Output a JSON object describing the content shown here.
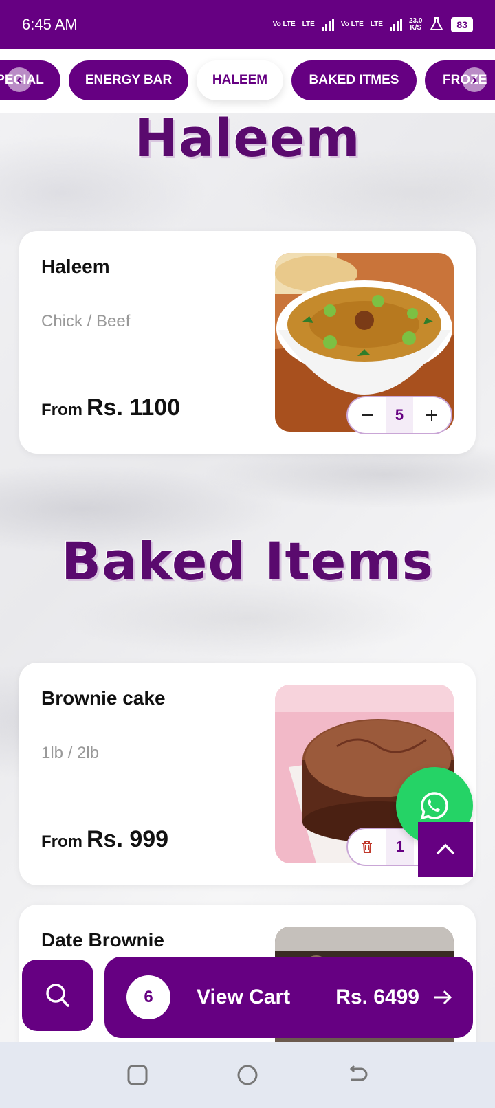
{
  "status_bar": {
    "time": "6:45 AM",
    "net1": "Vo LTE",
    "net2": "LTE",
    "net3": "Vo LTE",
    "net4": "LTE",
    "speed_value": "23.0",
    "speed_unit": "K/S",
    "battery": "83"
  },
  "categories": {
    "items": [
      {
        "label": "PECIAL"
      },
      {
        "label": "ENERGY BAR"
      },
      {
        "label": "HALEEM"
      },
      {
        "label": "BAKED ITMES"
      },
      {
        "label": "FROZE"
      }
    ],
    "active": "HALEEM",
    "prev_glyph": "‹",
    "next_glyph": "›"
  },
  "sections": [
    {
      "title": "Haleem",
      "products": [
        {
          "name": "Haleem",
          "variants": "Chick / Beef",
          "price_prefix": "From",
          "price": "Rs. 1100",
          "quantity": "5"
        }
      ]
    },
    {
      "title": "Baked Items",
      "products": [
        {
          "name": "Brownie cake",
          "variants": "1lb / 2lb",
          "price_prefix": "From",
          "price": "Rs. 999",
          "quantity": "1"
        },
        {
          "name": "Date Brownie"
        }
      ]
    }
  ],
  "cart": {
    "count": "6",
    "label": "View Cart",
    "total": "Rs. 6499"
  },
  "colors": {
    "brand": "#660082",
    "whatsapp": "#25d366"
  },
  "icons": [
    "search-icon",
    "arrow-right-icon",
    "whatsapp-icon",
    "chevron-up-icon",
    "trash-icon",
    "minus-icon",
    "plus-icon"
  ]
}
